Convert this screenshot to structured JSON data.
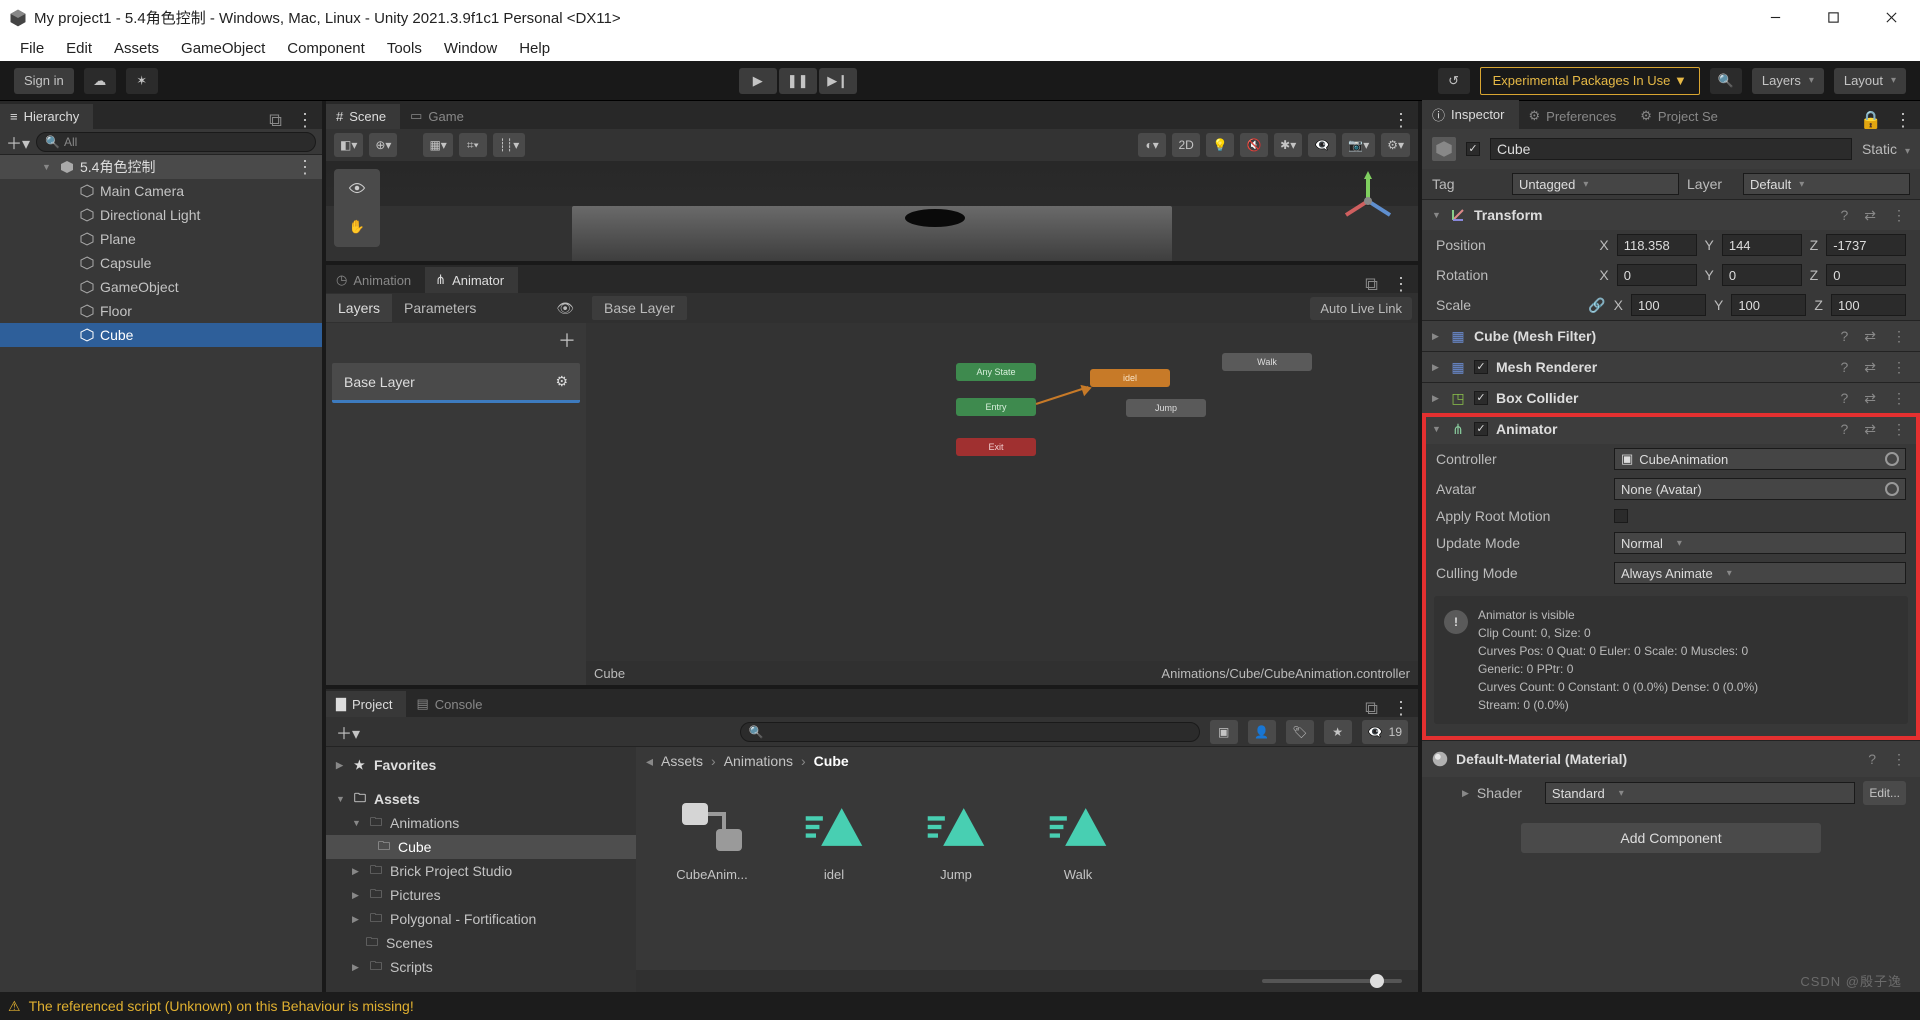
{
  "window": {
    "title": "My project1 - 5.4角色控制 - Windows, Mac, Linux - Unity 2021.3.9f1c1 Personal <DX11>"
  },
  "menubar": [
    "File",
    "Edit",
    "Assets",
    "GameObject",
    "Component",
    "Tools",
    "Window",
    "Help"
  ],
  "toolbar": {
    "signin": "Sign in",
    "experimental": "Experimental Packages In Use ▼",
    "layers": "Layers",
    "layout": "Layout"
  },
  "hierarchy": {
    "tab": "Hierarchy",
    "search_placeholder": "All",
    "scene": "5.4角色控制",
    "items": [
      {
        "name": "Main Camera"
      },
      {
        "name": "Directional Light"
      },
      {
        "name": "Plane"
      },
      {
        "name": "Capsule"
      },
      {
        "name": "GameObject"
      },
      {
        "name": "Floor"
      },
      {
        "name": "Cube",
        "selected": true
      }
    ]
  },
  "scene": {
    "tab_scene": "Scene",
    "tab_game": "Game",
    "btn_2d": "2D"
  },
  "animator": {
    "tab_anim": "Animation",
    "tab_animator": "Animator",
    "sub_layers": "Layers",
    "sub_params": "Parameters",
    "crumb": "Base Layer",
    "autolive": "Auto Live Link",
    "layer": "Base Layer",
    "footer_left": "Cube",
    "footer_right": "Animations/Cube/CubeAnimation.controller",
    "states": {
      "anystate": "Any State",
      "entry": "Entry",
      "exit": "Exit",
      "idel": "idel",
      "walk": "Walk",
      "jump": "Jump"
    }
  },
  "project": {
    "tab_project": "Project",
    "tab_console": "Console",
    "favorites": "Favorites",
    "root": "Assets",
    "folders": [
      "Animations",
      "Cube",
      "Brick Project Studio",
      "Pictures",
      "Polygonal - Fortification",
      "Scenes",
      "Scripts"
    ],
    "breadcrumb": [
      "Assets",
      "Animations",
      "Cube"
    ],
    "assets": [
      {
        "name": "CubeAnim...",
        "kind": "controller"
      },
      {
        "name": "idel",
        "kind": "clip"
      },
      {
        "name": "Jump",
        "kind": "clip"
      },
      {
        "name": "Walk",
        "kind": "clip"
      }
    ],
    "hidden_count": "19"
  },
  "inspector": {
    "tab_inspector": "Inspector",
    "tab_prefs": "Preferences",
    "tab_projset": "Project Se",
    "name": "Cube",
    "static": "Static",
    "tag_label": "Tag",
    "tag": "Untagged",
    "layer_label": "Layer",
    "layer": "Default",
    "transform": {
      "title": "Transform",
      "pos_label": "Position",
      "posx": "118.358",
      "posy": "144",
      "posz": "-1737",
      "rot_label": "Rotation",
      "rotx": "0",
      "roty": "0",
      "rotz": "0",
      "scale_label": "Scale",
      "sclx": "100",
      "scly": "100",
      "sclz": "100"
    },
    "comps": {
      "meshfilter": "Cube (Mesh Filter)",
      "meshrenderer": "Mesh Renderer",
      "boxcollider": "Box Collider",
      "animator": "Animator"
    },
    "animator": {
      "controller_label": "Controller",
      "controller": "CubeAnimation",
      "avatar_label": "Avatar",
      "avatar": "None (Avatar)",
      "apply_root": "Apply Root Motion",
      "update_label": "Update Mode",
      "update": "Normal",
      "culling_label": "Culling Mode",
      "culling": "Always Animate",
      "info_l1": "Animator is visible",
      "info_l2": "Clip Count: 0, Size: 0",
      "info_l3": "Curves Pos: 0 Quat: 0 Euler: 0 Scale: 0 Muscles: 0",
      "info_l4": "Generic: 0 PPtr: 0",
      "info_l5": "Curves Count: 0 Constant: 0 (0.0%) Dense: 0 (0.0%)",
      "info_l6": "Stream: 0 (0.0%)"
    },
    "material": {
      "title": "Default-Material (Material)",
      "shader_label": "Shader",
      "shader": "Standard",
      "edit": "Edit..."
    },
    "add_component": "Add Component"
  },
  "statusbar": {
    "msg": "The referenced script (Unknown) on this Behaviour is missing!"
  },
  "watermark": "CSDN @殷子逸"
}
